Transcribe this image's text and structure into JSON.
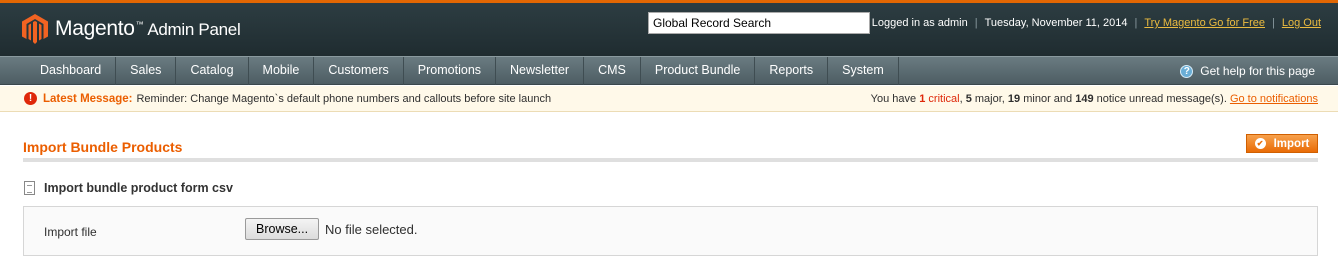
{
  "header": {
    "logo_text": "Magento",
    "logo_tm": "™",
    "logo_sub": "Admin Panel",
    "search_value": "Global Record Search",
    "logged_in": "Logged in as admin",
    "date": "Tuesday, November 11, 2014",
    "try_link": "Try Magento Go for Free",
    "logout": "Log Out",
    "separator": "|"
  },
  "nav": {
    "items": [
      "Dashboard",
      "Sales",
      "Catalog",
      "Mobile",
      "Customers",
      "Promotions",
      "Newsletter",
      "CMS",
      "Product Bundle",
      "Reports",
      "System"
    ],
    "help": "Get help for this page"
  },
  "message": {
    "label": "Latest Message:",
    "text": "Reminder: Change Magento`s default phone numbers and callouts before site launch",
    "you_have": "You have",
    "critical_count": "1",
    "critical_label": "critical",
    "major": "5",
    "major_label": "major,",
    "minor": "19",
    "minor_label": "minor and",
    "notice": "149",
    "notice_label": "notice unread message(s).",
    "notif_link": "Go to notifications"
  },
  "content": {
    "title": "Import Bundle Products",
    "import_button": "Import",
    "section_title": "Import bundle product form csv",
    "field_label": "Import file",
    "browse_label": "Browse...",
    "file_status": "No file selected."
  },
  "colors": {
    "accent": "#eb5e00",
    "header_top": "#e26703",
    "critical": "#df280a"
  }
}
